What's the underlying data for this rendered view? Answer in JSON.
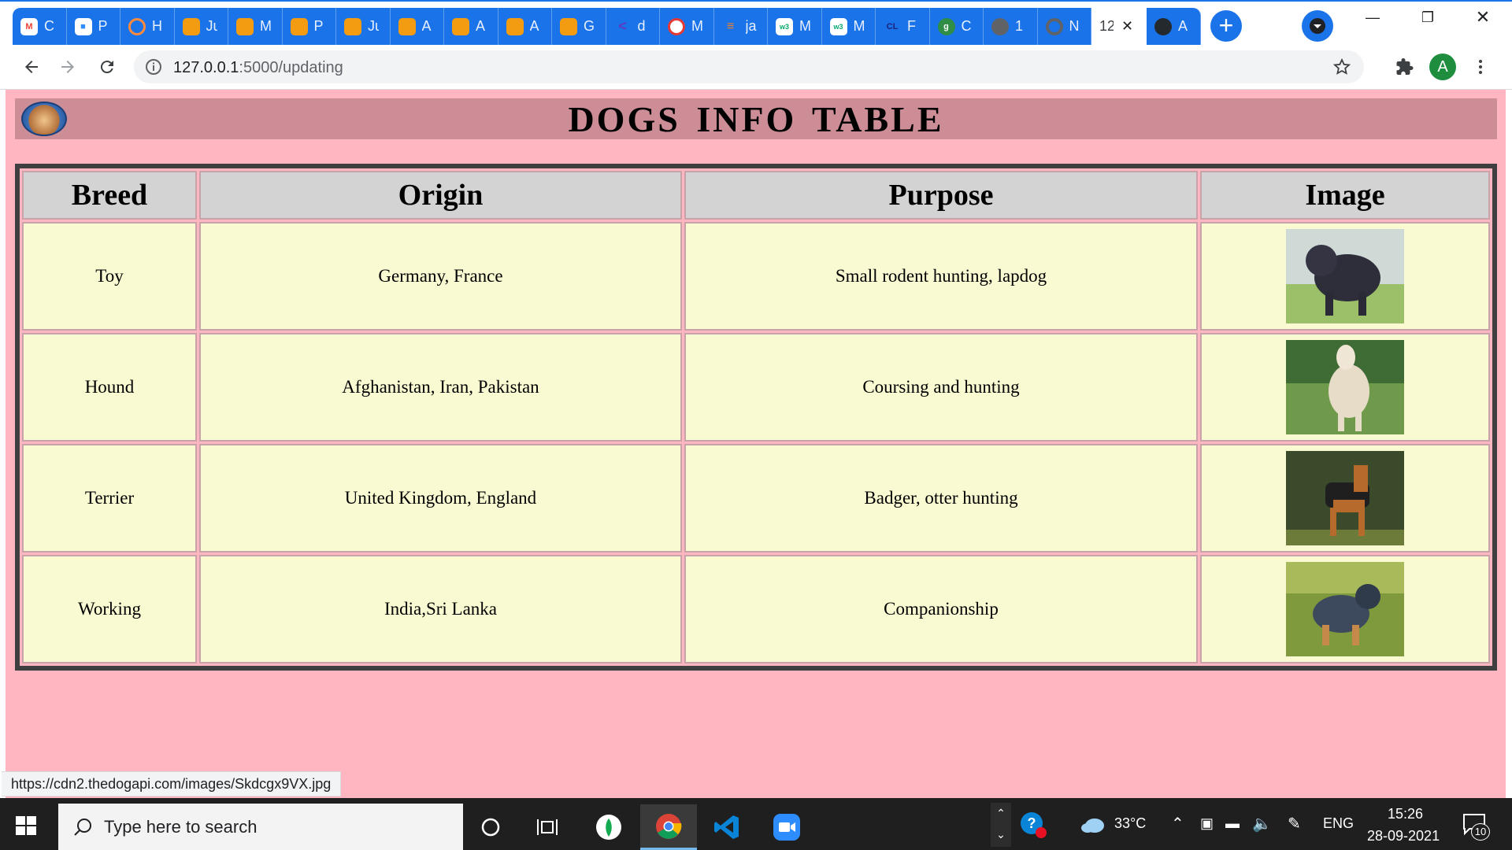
{
  "browser": {
    "tabs": [
      {
        "title": "C",
        "icon": "gmail-icon",
        "color": "#ffffff"
      },
      {
        "title": "P",
        "icon": "zoom-icon",
        "color": "#2d8cff"
      },
      {
        "title": "H",
        "icon": "hackerrank-icon",
        "color": "#ff8a3d"
      },
      {
        "title": "Ju",
        "icon": "book-icon",
        "color": "#f39c12"
      },
      {
        "title": "M",
        "icon": "book-icon",
        "color": "#f39c12"
      },
      {
        "title": "P",
        "icon": "book-icon",
        "color": "#f39c12"
      },
      {
        "title": "Ju",
        "icon": "book-icon",
        "color": "#f39c12"
      },
      {
        "title": "A",
        "icon": "book-icon",
        "color": "#f39c12"
      },
      {
        "title": "A",
        "icon": "book-icon",
        "color": "#f39c12"
      },
      {
        "title": "A",
        "icon": "book-icon",
        "color": "#f39c12"
      },
      {
        "title": "G",
        "icon": "book-icon",
        "color": "#f39c12"
      },
      {
        "title": "d",
        "icon": "code-icon",
        "color": "#5b3cc4"
      },
      {
        "title": "M",
        "icon": "codechef-icon",
        "color": "#e53935"
      },
      {
        "title": "ja",
        "icon": "stackoverflow-icon",
        "color": "#f48024"
      },
      {
        "title": "M",
        "icon": "w3schools-icon",
        "color": "#ffffff"
      },
      {
        "title": "M",
        "icon": "w3schools-icon",
        "color": "#ffffff"
      },
      {
        "title": "F",
        "icon": "cl-icon",
        "color": "#1a237e"
      },
      {
        "title": "C",
        "icon": "geeksforgeeks-icon",
        "color": "#2f8d46"
      },
      {
        "title": "1",
        "icon": "globe-icon",
        "color": "#5f6368"
      },
      {
        "title": "N",
        "icon": "chrome-icon",
        "color": "#5f6368"
      },
      {
        "title": "12",
        "icon": "page-icon",
        "color": "#ffffff",
        "active": true
      },
      {
        "title": "A",
        "icon": "github-icon",
        "color": "#24292e"
      }
    ],
    "url_host": "127.0.0.1",
    "url_rest": ":5000/updating",
    "profile_initial": "A",
    "status_url": "https://cdn2.thedogapi.com/images/Skdcgx9VX.jpg"
  },
  "page": {
    "title": "DOGS INFO TABLE",
    "headers": [
      "Breed",
      "Origin",
      "Purpose",
      "Image"
    ],
    "rows": [
      {
        "breed": "Toy",
        "origin": "Germany, France",
        "purpose": "Small rodent hunting, lapdog",
        "image": "dog-photo"
      },
      {
        "breed": "Hound",
        "origin": "Afghanistan, Iran, Pakistan",
        "purpose": "Coursing and hunting",
        "image": "dog-photo"
      },
      {
        "breed": "Terrier",
        "origin": "United Kingdom, England",
        "purpose": "Badger, otter hunting",
        "image": "dog-photo"
      },
      {
        "breed": "Working",
        "origin": "India,Sri Lanka",
        "purpose": "Companionship",
        "image": "dog-photo"
      }
    ]
  },
  "taskbar": {
    "search_placeholder": "Type here to search",
    "weather": "33°C",
    "language": "ENG",
    "time": "15:26",
    "date": "28-09-2021",
    "notifications": "10"
  },
  "colors": {
    "page_bg": "#ffb6c1",
    "header_bg": "#cd8d96",
    "th_bg": "#d3d3d3",
    "td_bg": "#fafad2",
    "tab_blue": "#1a73e8"
  }
}
